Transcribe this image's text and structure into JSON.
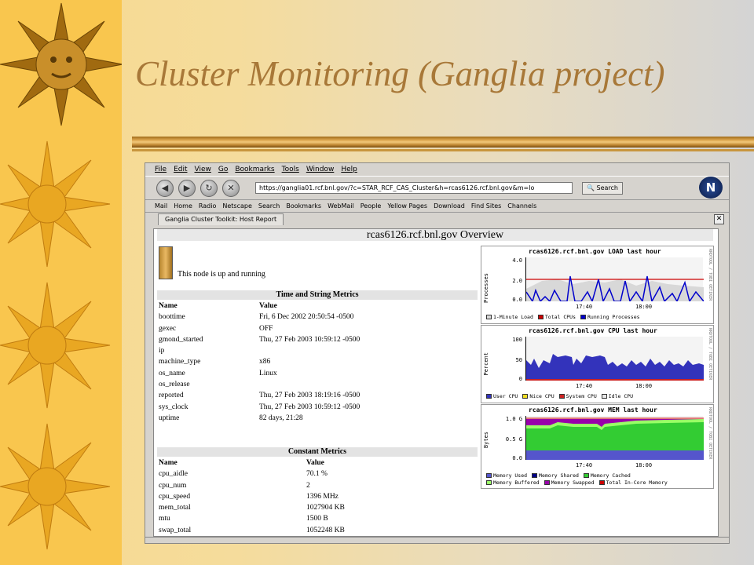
{
  "slide": {
    "title": "Cluster Monitoring (Ganglia project)"
  },
  "colors": {
    "slide_accent": "#f9c64e",
    "title_color": "#a87838"
  },
  "browser": {
    "menu": [
      "File",
      "Edit",
      "View",
      "Go",
      "Bookmarks",
      "Tools",
      "Window",
      "Help"
    ],
    "url": "https://ganglia01.rcf.bnl.gov/?c=STAR_RCF_CAS_Cluster&h=rcas6126.rcf.bnl.gov&m=lo",
    "search_label": "Search",
    "bookmarks": [
      "Mail",
      "Home",
      "Radio",
      "Netscape",
      "Search",
      "Bookmarks",
      "WebMail",
      "People",
      "Yellow Pages",
      "Download",
      "Find Sites",
      "Channels"
    ],
    "tab_label": "Ganglia Cluster Toolkit: Host Report",
    "logo": "N"
  },
  "page": {
    "heading": "rcas6126.rcf.bnl.gov Overview",
    "status": "This node is up and running",
    "time_string": {
      "title": "Time and String Metrics",
      "col_name": "Name",
      "col_value": "Value",
      "rows": [
        {
          "name": "boottime",
          "value": "Fri, 6 Dec 2002 20:50:54 -0500"
        },
        {
          "name": "gexec",
          "value": "OFF"
        },
        {
          "name": "gmond_started",
          "value": "Thu, 27 Feb 2003 10:59:12 -0500"
        },
        {
          "name": "ip",
          "value": ""
        },
        {
          "name": "machine_type",
          "value": "x86"
        },
        {
          "name": "os_name",
          "value": "Linux"
        },
        {
          "name": "os_release",
          "value": ""
        },
        {
          "name": "reported",
          "value": "Thu, 27 Feb 2003 18:19:16 -0500"
        },
        {
          "name": "sys_clock",
          "value": "Thu, 27 Feb 2003 10:59:12 -0500"
        },
        {
          "name": "uptime",
          "value": "82 days, 21:28"
        }
      ]
    },
    "constant": {
      "title": "Constant Metrics",
      "col_name": "Name",
      "col_value": "Value",
      "rows": [
        {
          "name": "cpu_aidle",
          "value": "70.1 %"
        },
        {
          "name": "cpu_num",
          "value": "2"
        },
        {
          "name": "cpu_speed",
          "value": "1396 MHz"
        },
        {
          "name": "mem_total",
          "value": "1027904 KB"
        },
        {
          "name": "mtu",
          "value": "1500 B"
        },
        {
          "name": "swap_total",
          "value": "1052248 KB"
        }
      ]
    }
  },
  "graphs": {
    "load": {
      "title": "rcas6126.rcf.bnl.gov LOAD last hour",
      "ylabel": "Processes",
      "side": "RRDTOOL / TOBI OETIKER",
      "yticks": [
        "4.0",
        "2.0",
        "0.0"
      ],
      "xticks": [
        "17:40",
        "18:00"
      ],
      "legend": [
        {
          "label": "1-Minute Load",
          "color": "#d8d8d8"
        },
        {
          "label": "Total CPUs",
          "color": "#cc0000"
        },
        {
          "label": "Running Processes",
          "color": "#0000cc"
        }
      ]
    },
    "cpu": {
      "title": "rcas6126.rcf.bnl.gov CPU last hour",
      "ylabel": "Percent",
      "side": "RRDTOOL / TOBI OETIKER",
      "yticks": [
        "100",
        "50",
        "0"
      ],
      "xticks": [
        "17:40",
        "18:00"
      ],
      "legend": [
        {
          "label": "User CPU",
          "color": "#3333bb"
        },
        {
          "label": "Nice CPU",
          "color": "#eedd22"
        },
        {
          "label": "System CPU",
          "color": "#cc2222"
        },
        {
          "label": "Idle CPU",
          "color": "#e8e8e8"
        }
      ]
    },
    "mem": {
      "title": "rcas6126.rcf.bnl.gov MEM last hour",
      "ylabel": "Bytes",
      "side": "RRDTOOL / TOBI OETIKER",
      "yticks": [
        "1.0 G",
        "0.5 G",
        "0.0"
      ],
      "xticks": [
        "17:40",
        "18:00"
      ],
      "legend": [
        {
          "label": "Memory Used",
          "color": "#5555cc"
        },
        {
          "label": "Memory Shared",
          "color": "#000088"
        },
        {
          "label": "Memory Cached",
          "color": "#33cc33"
        },
        {
          "label": "Memory Buffered",
          "color": "#99ff66"
        },
        {
          "label": "Memory Swapped",
          "color": "#9900aa"
        },
        {
          "label": "Total In-Core Memory",
          "color": "#cc0000"
        }
      ]
    }
  }
}
